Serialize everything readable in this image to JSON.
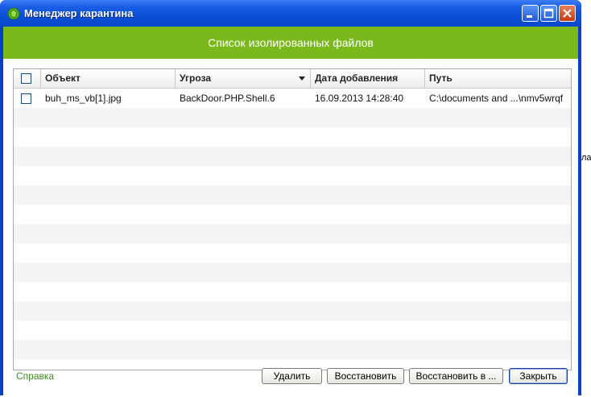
{
  "window": {
    "title": "Менеджер карантина",
    "banner": "Список изолированных файлов"
  },
  "table": {
    "columns": [
      "Объект",
      "Угроза",
      "Дата добавления",
      "Путь"
    ],
    "rows": [
      {
        "object": "buh_ms_vb[1].jpg",
        "threat": "BackDoor.PHP.Shell.6",
        "date": "16.09.2013 14:28:40",
        "path": "C:\\documents and ...\\nmv5wrqf"
      }
    ]
  },
  "footer": {
    "help": "Справка",
    "delete": "Удалить",
    "restore": "Восстановить",
    "restore_to": "Восстановить в ...",
    "close": "Закрыть"
  },
  "colors": {
    "banner": "#7bb81b",
    "titlebar": "#0a4fd6"
  }
}
